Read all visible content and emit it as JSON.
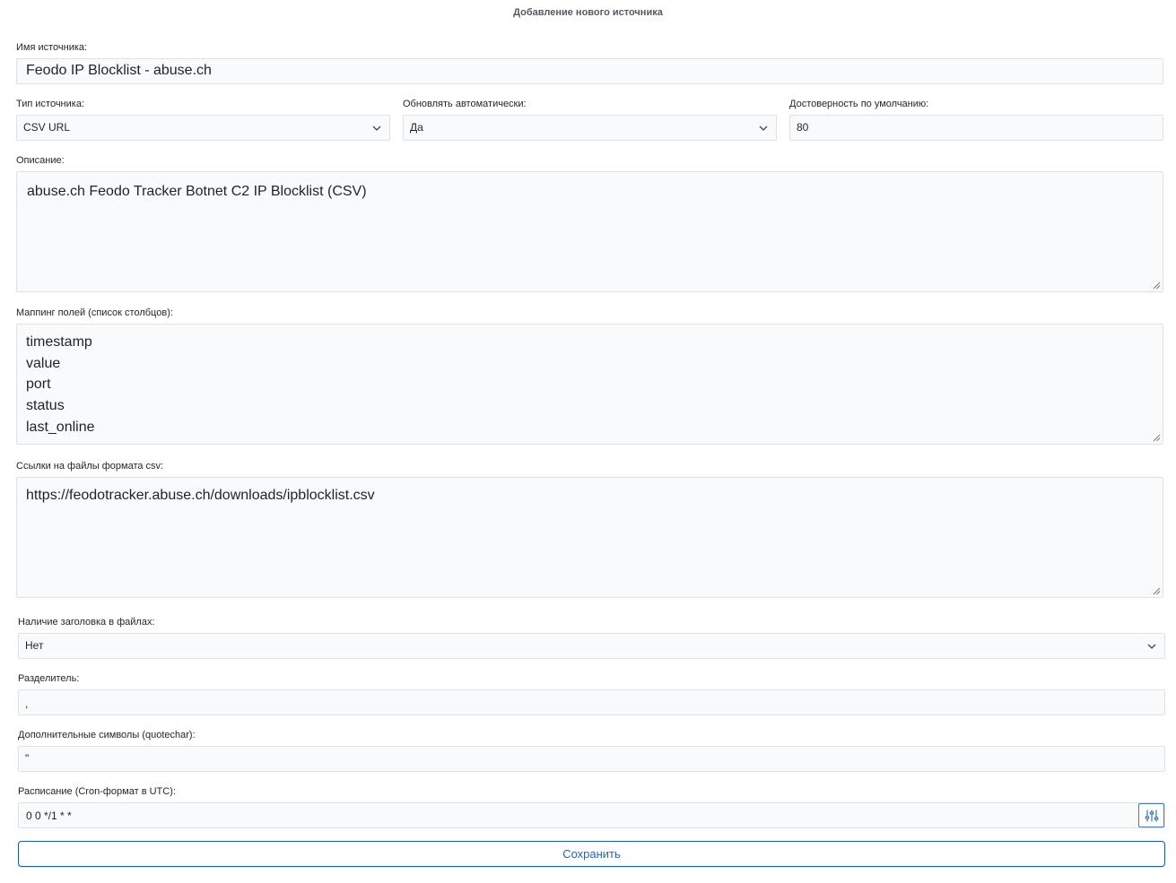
{
  "form": {
    "title": "Добавление нового источника"
  },
  "source_name": {
    "label": "Имя источника:",
    "value": "Feodo IP Blocklist - abuse.ch"
  },
  "source_type": {
    "label": "Тип источника:",
    "selected": "CSV URL"
  },
  "auto_update": {
    "label": "Обновлять автоматически:",
    "selected": "Да"
  },
  "default_confidence": {
    "label": "Достоверность по умолчанию:",
    "value": "80"
  },
  "description": {
    "label": "Описание:",
    "value": "abuse.ch Feodo Tracker Botnet C2 IP Blocklist (CSV)"
  },
  "field_mapping": {
    "label": "Маппинг полей (список столбцов):",
    "lines": [
      "timestamp",
      "value",
      "port",
      "status",
      "last_online"
    ]
  },
  "csv_links": {
    "label": "Ссылки на файлы формата csv:",
    "value": "https://feodotracker.abuse.ch/downloads/ipblocklist.csv"
  },
  "has_header": {
    "label": "Наличие заголовка в файлах:",
    "selected": "Нет"
  },
  "delimiter": {
    "label": "Разделитель:",
    "value": ","
  },
  "quotechar": {
    "label": "Дополнительные символы (quotechar):",
    "value": "\""
  },
  "schedule": {
    "label": "Расписание (Cron-формат в UTC):",
    "value": "0 0 */1 * *"
  },
  "actions": {
    "save_label": "Сохранить"
  },
  "icons": {
    "select_arrow": "chevron-down-icon",
    "cron_builder": "sliders-icon",
    "resize": "resize-grip-icon"
  },
  "colors": {
    "field_background": "#f8fafc",
    "field_border": "#dde2e7",
    "accent": "#2a66a3",
    "button_border": "#1f5c99"
  }
}
